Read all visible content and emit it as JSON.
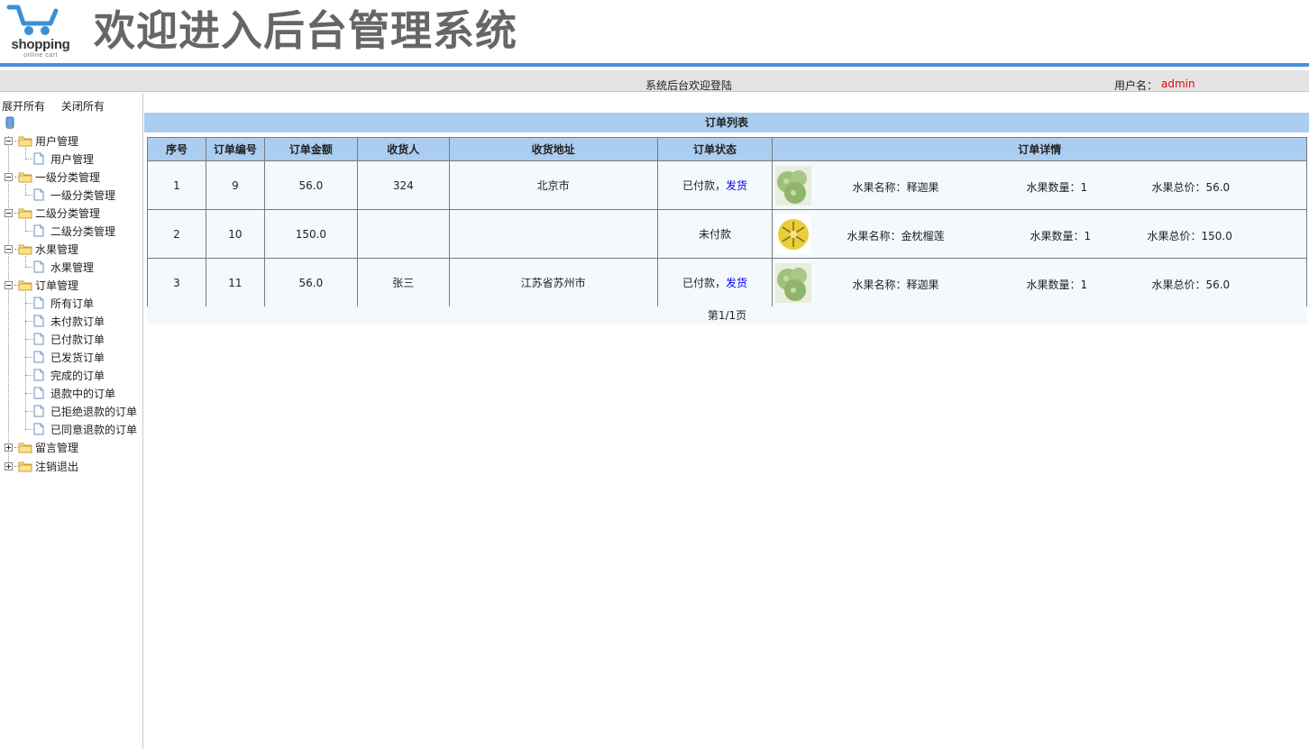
{
  "header": {
    "logo_text": "shopping",
    "logo_sub": "online cart",
    "title": "欢迎进入后台管理系统"
  },
  "topbar": {
    "welcome": "系统后台欢迎登陆",
    "user_label": "用户名：",
    "user_name": "admin"
  },
  "sidebar": {
    "expand_all": "展开所有",
    "collapse_all": "关闭所有",
    "items": [
      {
        "label": "用户管理",
        "children": [
          "用户管理"
        ]
      },
      {
        "label": "一级分类管理",
        "children": [
          "一级分类管理"
        ]
      },
      {
        "label": "二级分类管理",
        "children": [
          "二级分类管理"
        ]
      },
      {
        "label": "水果管理",
        "children": [
          "水果管理"
        ]
      },
      {
        "label": "订单管理",
        "children": [
          "所有订单",
          "未付款订单",
          "已付款订单",
          "已发货订单",
          "完成的订单",
          "退款中的订单",
          "已拒绝退款的订单",
          "已同意退款的订单"
        ]
      },
      {
        "label": "留言管理",
        "children": []
      },
      {
        "label": "注销退出",
        "children": []
      }
    ]
  },
  "orders": {
    "title": "订单列表",
    "columns": [
      "序号",
      "订单编号",
      "订单金额",
      "收货人",
      "收货地址",
      "订单状态",
      "订单详情"
    ],
    "rows": [
      {
        "seq": "1",
        "order_no": "9",
        "amount": "56.0",
        "receiver": "324",
        "address": "北京市",
        "status": "已付款，",
        "action": "发货",
        "fruit_name": "水果名称：释迦果",
        "fruit_qty": "水果数量：1",
        "fruit_total": "水果总价：56.0",
        "image": "custard-apple"
      },
      {
        "seq": "2",
        "order_no": "10",
        "amount": "150.0",
        "receiver": "",
        "address": "",
        "status": "未付款",
        "action": "",
        "fruit_name": "水果名称：金枕榴莲",
        "fruit_qty": "水果数量：1",
        "fruit_total": "水果总价：150.0",
        "image": "durian"
      },
      {
        "seq": "3",
        "order_no": "11",
        "amount": "56.0",
        "receiver": "张三",
        "address": "江苏省苏州市",
        "status": "已付款，",
        "action": "发货",
        "fruit_name": "水果名称：释迦果",
        "fruit_qty": "水果数量：1",
        "fruit_total": "水果总价：56.0",
        "image": "custard-apple"
      }
    ],
    "pager": "第1/1页"
  },
  "colors": {
    "accent": "#4a90d9",
    "table_header": "#abcdf0",
    "username": "#ee0000",
    "link": "#0000ee"
  }
}
